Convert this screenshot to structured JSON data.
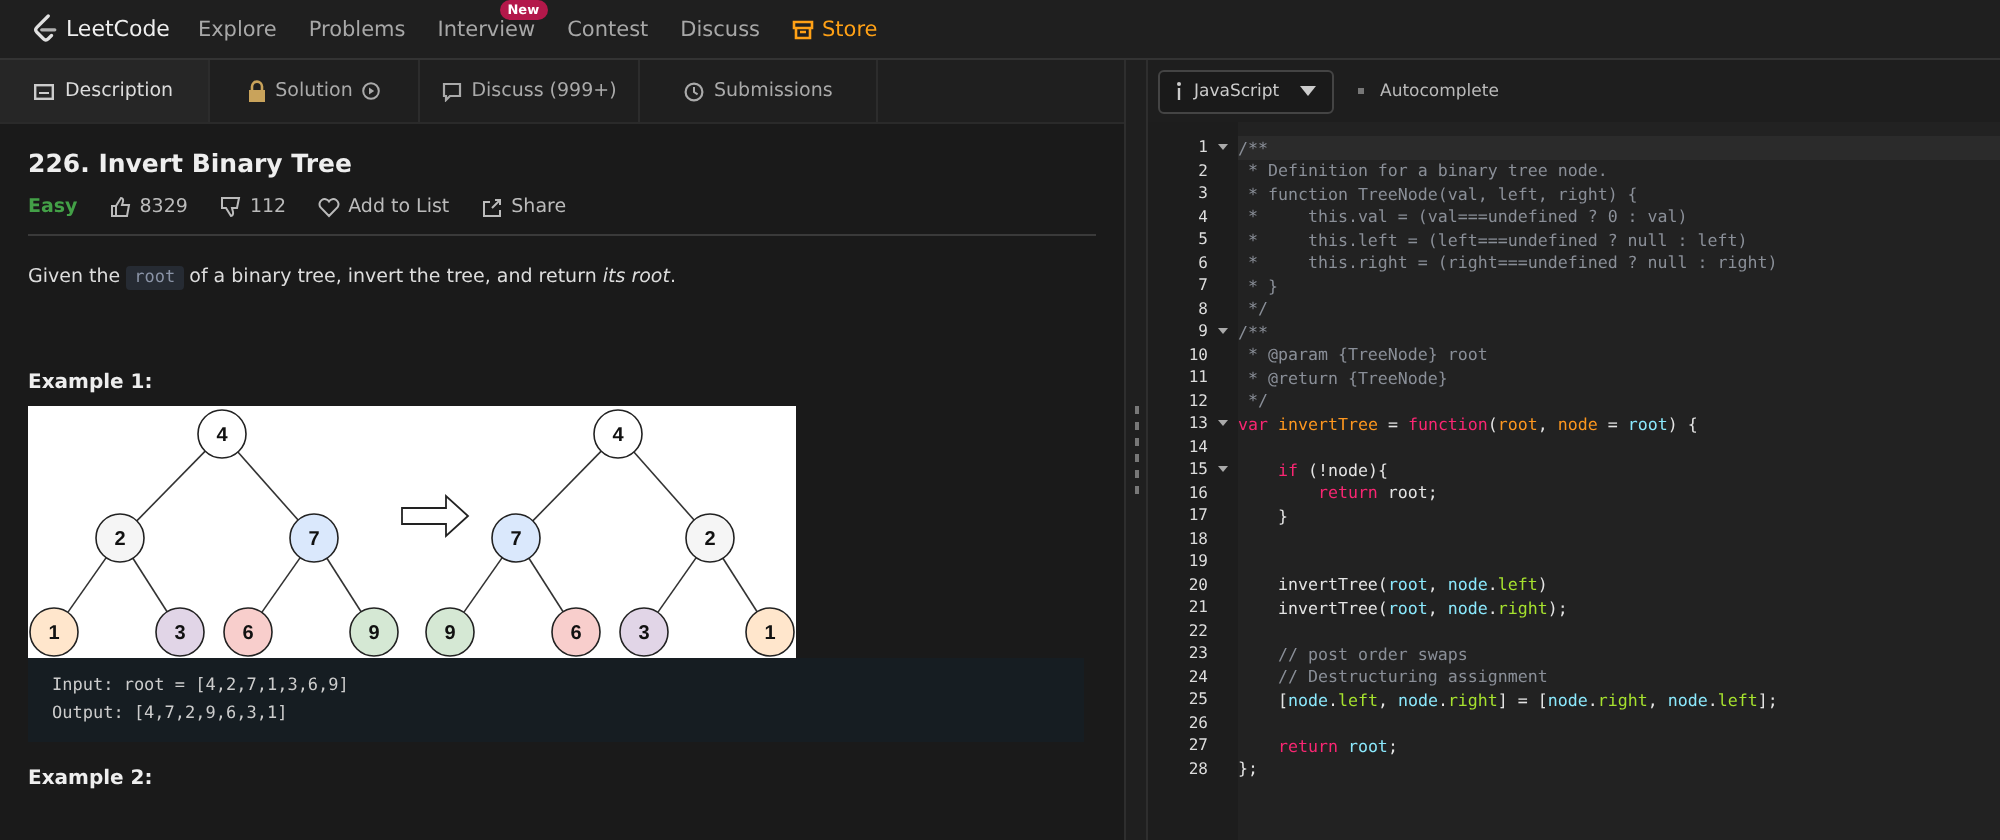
{
  "nav": {
    "brand": "LeetCode",
    "items": [
      {
        "label": "Explore",
        "highlight": false
      },
      {
        "label": "Problems",
        "highlight": false
      },
      {
        "label": "Interview",
        "highlight": false,
        "badge": "New"
      },
      {
        "label": "Contest",
        "highlight": false
      },
      {
        "label": "Discuss",
        "highlight": false
      },
      {
        "label": "Store",
        "highlight": true
      }
    ]
  },
  "tabs": [
    {
      "label": "Description",
      "kind": "description",
      "selected": true
    },
    {
      "label": "Solution",
      "kind": "solution",
      "selected": false
    },
    {
      "label": "Discuss (999+)",
      "kind": "discuss",
      "selected": false
    },
    {
      "label": "Submissions",
      "kind": "submissions",
      "selected": false
    }
  ],
  "problem": {
    "title": "226. Invert Binary Tree",
    "difficulty": "Easy",
    "likes": "8329",
    "dislikes": "112",
    "add_to_list": "Add to List",
    "share": "Share",
    "description": [
      {
        "kind": "text",
        "text": "Given the "
      },
      {
        "kind": "code",
        "text": "root"
      },
      {
        "kind": "text",
        "text": " of a binary tree, invert the tree, and return *its root*."
      }
    ],
    "examples": [
      {
        "heading": "Example 1:",
        "input_tree": {
          "value": "4",
          "color": "#ffffff",
          "children": [
            {
              "value": "2",
              "color": "#f5f5f5",
              "children": [
                {
                  "value": "1",
                  "color": "#ffe6cc"
                },
                {
                  "value": "3",
                  "color": "#e1d5e7"
                }
              ]
            },
            {
              "value": "7",
              "color": "#dae8fc",
              "children": [
                {
                  "value": "6",
                  "color": "#f8cecc"
                },
                {
                  "value": "9",
                  "color": "#d5e8d4"
                }
              ]
            }
          ]
        },
        "output_tree": {
          "value": "4",
          "color": "#ffffff",
          "children": [
            {
              "value": "7",
              "color": "#dae8fc",
              "children": [
                {
                  "value": "9",
                  "color": "#d5e8d4"
                },
                {
                  "value": "6",
                  "color": "#f8cecc"
                }
              ]
            },
            {
              "value": "2",
              "color": "#f5f5f5",
              "children": [
                {
                  "value": "3",
                  "color": "#e1d5e7"
                },
                {
                  "value": "1",
                  "color": "#ffe6cc"
                }
              ]
            }
          ]
        },
        "lines": [
          "Input: root = [4,2,7,1,3,6,9]",
          "Output: [4,7,2,9,6,3,1]"
        ]
      },
      {
        "heading": "Example 2:"
      }
    ]
  },
  "editor": {
    "language": "JavaScript",
    "autocomplete": "Autocomplete",
    "lines": [
      {
        "number": "1",
        "fold": true,
        "active": true,
        "tokens": [
          {
            "kind": "comment",
            "text": "/**"
          }
        ]
      },
      {
        "number": "2",
        "fold": false,
        "active": false,
        "tokens": [
          {
            "kind": "comment",
            "text": " * Definition for a binary tree node."
          }
        ]
      },
      {
        "number": "3",
        "fold": false,
        "active": false,
        "tokens": [
          {
            "kind": "comment",
            "text": " * function TreeNode(val, left, right) {"
          }
        ]
      },
      {
        "number": "4",
        "fold": false,
        "active": false,
        "tokens": [
          {
            "kind": "comment",
            "text": " *     this.val = (val===undefined ? 0 : val)"
          }
        ]
      },
      {
        "number": "5",
        "fold": false,
        "active": false,
        "tokens": [
          {
            "kind": "comment",
            "text": " *     this.left = (left===undefined ? null : left)"
          }
        ]
      },
      {
        "number": "6",
        "fold": false,
        "active": false,
        "tokens": [
          {
            "kind": "comment",
            "text": " *     this.right = (right===undefined ? null : right)"
          }
        ]
      },
      {
        "number": "7",
        "fold": false,
        "active": false,
        "tokens": [
          {
            "kind": "comment",
            "text": " * }"
          }
        ]
      },
      {
        "number": "8",
        "fold": false,
        "active": false,
        "tokens": [
          {
            "kind": "comment",
            "text": " */"
          }
        ]
      },
      {
        "number": "9",
        "fold": true,
        "active": false,
        "tokens": [
          {
            "kind": "comment",
            "text": "/**"
          }
        ]
      },
      {
        "number": "10",
        "fold": false,
        "active": false,
        "tokens": [
          {
            "kind": "comment",
            "text": " * @param {TreeNode} root"
          }
        ]
      },
      {
        "number": "11",
        "fold": false,
        "active": false,
        "tokens": [
          {
            "kind": "comment",
            "text": " * @return {TreeNode}"
          }
        ]
      },
      {
        "number": "12",
        "fold": false,
        "active": false,
        "tokens": [
          {
            "kind": "comment",
            "text": " */"
          }
        ]
      },
      {
        "number": "13",
        "fold": true,
        "active": false,
        "tokens": [
          {
            "kind": "keyword",
            "text": "var"
          },
          {
            "kind": "name",
            "text": " invertTree"
          },
          {
            "kind": "plain",
            "text": " = "
          },
          {
            "kind": "keyword",
            "text": "function"
          },
          {
            "kind": "plain",
            "text": "("
          },
          {
            "kind": "name",
            "text": "root"
          },
          {
            "kind": "plain",
            "text": ", "
          },
          {
            "kind": "name",
            "text": "node"
          },
          {
            "kind": "plain",
            "text": " = "
          },
          {
            "kind": "ident",
            "text": "root"
          },
          {
            "kind": "plain",
            "text": ") {"
          }
        ]
      },
      {
        "number": "14",
        "fold": false,
        "active": false
      },
      {
        "number": "15",
        "fold": true,
        "active": false,
        "tokens": [
          {
            "kind": "keyword",
            "text": "    if"
          },
          {
            "kind": "plain",
            "text": " (!node){"
          }
        ]
      },
      {
        "number": "16",
        "fold": false,
        "active": false,
        "tokens": [
          {
            "kind": "keyword",
            "text": "        return"
          },
          {
            "kind": "plain",
            "text": " root;"
          }
        ]
      },
      {
        "number": "17",
        "fold": false,
        "active": false,
        "tokens": [
          {
            "kind": "plain",
            "text": "    }"
          }
        ]
      },
      {
        "number": "18",
        "fold": false,
        "active": false
      },
      {
        "number": "19",
        "fold": false,
        "active": false
      },
      {
        "number": "20",
        "fold": false,
        "active": false,
        "tokens": [
          {
            "kind": "plain",
            "text": "    invertTree("
          },
          {
            "kind": "ident",
            "text": "root"
          },
          {
            "kind": "plain",
            "text": ", "
          },
          {
            "kind": "ident",
            "text": "node"
          },
          {
            "kind": "plain",
            "text": "."
          },
          {
            "kind": "prop",
            "text": "left"
          },
          {
            "kind": "plain",
            "text": ")"
          }
        ]
      },
      {
        "number": "21",
        "fold": false,
        "active": false,
        "tokens": [
          {
            "kind": "plain",
            "text": "    invertTree("
          },
          {
            "kind": "ident",
            "text": "root"
          },
          {
            "kind": "plain",
            "text": ", "
          },
          {
            "kind": "ident",
            "text": "node"
          },
          {
            "kind": "plain",
            "text": "."
          },
          {
            "kind": "prop",
            "text": "right"
          },
          {
            "kind": "plain",
            "text": ");"
          }
        ]
      },
      {
        "number": "22",
        "fold": false,
        "active": false
      },
      {
        "number": "23",
        "fold": false,
        "active": false,
        "tokens": [
          {
            "kind": "comment",
            "text": "    // post order swaps"
          }
        ]
      },
      {
        "number": "24",
        "fold": false,
        "active": false,
        "tokens": [
          {
            "kind": "comment",
            "text": "    // Destructuring assignment"
          }
        ]
      },
      {
        "number": "25",
        "fold": false,
        "active": false,
        "tokens": [
          {
            "kind": "plain",
            "text": "    ["
          },
          {
            "kind": "ident",
            "text": "node"
          },
          {
            "kind": "plain",
            "text": "."
          },
          {
            "kind": "prop",
            "text": "left"
          },
          {
            "kind": "plain",
            "text": ", "
          },
          {
            "kind": "ident",
            "text": "node"
          },
          {
            "kind": "plain",
            "text": "."
          },
          {
            "kind": "prop",
            "text": "right"
          },
          {
            "kind": "plain",
            "text": "] = ["
          },
          {
            "kind": "ident",
            "text": "node"
          },
          {
            "kind": "plain",
            "text": "."
          },
          {
            "kind": "prop",
            "text": "right"
          },
          {
            "kind": "plain",
            "text": ", "
          },
          {
            "kind": "ident",
            "text": "node"
          },
          {
            "kind": "plain",
            "text": "."
          },
          {
            "kind": "prop",
            "text": "left"
          },
          {
            "kind": "plain",
            "text": "];"
          }
        ]
      },
      {
        "number": "26",
        "fold": false,
        "active": false
      },
      {
        "number": "27",
        "fold": false,
        "active": false,
        "tokens": [
          {
            "kind": "keyword",
            "text": "    return"
          },
          {
            "kind": "ident",
            "text": " root"
          },
          {
            "kind": "plain",
            "text": ";"
          }
        ]
      },
      {
        "number": "28",
        "fold": false,
        "active": false,
        "tokens": [
          {
            "kind": "plain",
            "text": "};"
          }
        ]
      }
    ]
  }
}
